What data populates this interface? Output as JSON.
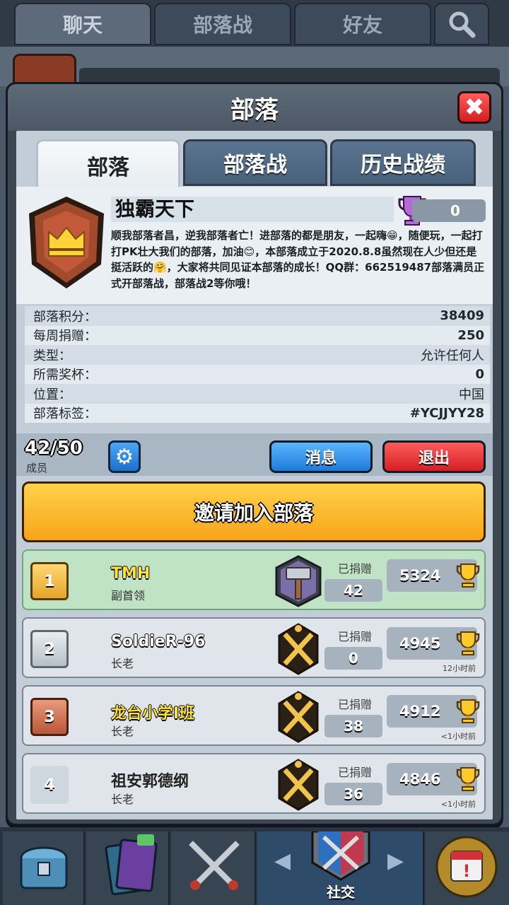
{
  "top_tabs": [
    {
      "label": "聊天"
    },
    {
      "label": "部落战"
    },
    {
      "label": "好友"
    }
  ],
  "panel": {
    "title": "部落",
    "close_label": "✖"
  },
  "tabs": [
    {
      "label": "部落"
    },
    {
      "label": "部落战"
    },
    {
      "label": "历史战绩"
    }
  ],
  "clan": {
    "name": "独霸天下",
    "trophies": "0",
    "description": "顺我部落者昌，逆我部落者亡！进部落的都是朋友，一起嗨😁，随便玩，一起打打PK壮大我们的部落，加油😊，本部落成立于2020.8.8虽然现在人少但还是挺活跃的🤗，大家将共同见证本部落的成长！QQ群：662519487部落满员正式开部落战，部落战2等你哦！"
  },
  "stats": [
    {
      "label": "部落积分：",
      "value": "38409"
    },
    {
      "label": "每周捐赠：",
      "value": "250"
    },
    {
      "label": "类型：",
      "value": "允许任何人"
    },
    {
      "label": "所需奖杯：",
      "value": "0"
    },
    {
      "label": "位置：",
      "value": "中国"
    },
    {
      "label": "部落标签：",
      "value": "#YCJJYY28"
    }
  ],
  "members_bar": {
    "count": "42/50",
    "count_label": "成员",
    "message_button": "消息",
    "leave_button": "退出"
  },
  "invite_button": "邀请加入部落",
  "members": [
    {
      "rank": "1",
      "name": "TMH",
      "role": "副首领",
      "donated_label": "已捐赠",
      "donated": "42",
      "trophies": "5324",
      "last_seen": ""
    },
    {
      "rank": "2",
      "name": "SoldieR-96",
      "role": "长老",
      "donated_label": "已捐赠",
      "donated": "0",
      "trophies": "4945",
      "last_seen": "12小时前"
    },
    {
      "rank": "3",
      "name": "龙台小学I班",
      "role": "长老",
      "donated_label": "已捐赠",
      "donated": "38",
      "trophies": "4912",
      "last_seen": "<1小时前"
    },
    {
      "rank": "4",
      "name": "祖安郭德纲",
      "role": "长老",
      "donated_label": "已捐赠",
      "donated": "36",
      "trophies": "4846",
      "last_seen": "<1小时前"
    }
  ],
  "bottom_nav": {
    "active_label": "社交"
  },
  "colors": {
    "accent_gold": "#f7a318",
    "button_blue": "#1f7ad8",
    "button_red": "#d41f23",
    "panel": "#3d4753"
  }
}
